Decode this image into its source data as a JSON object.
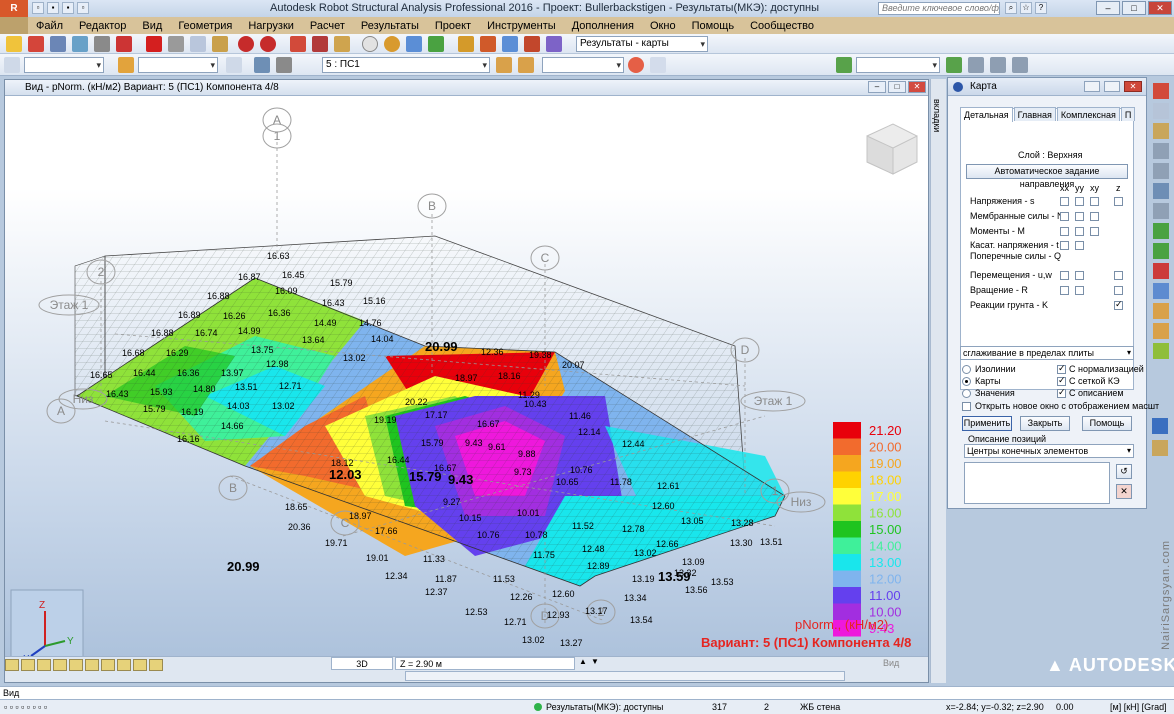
{
  "window": {
    "title": "Autodesk Robot Structural Analysis Professional 2016 - Проект: Bullerbackstigen - Результаты(МКЭ): доступны",
    "help_placeholder": "Введите ключевое слово/фразу",
    "app_logo": "R"
  },
  "menu": [
    "Файл",
    "Редактор",
    "Вид",
    "Геометрия",
    "Нагрузки",
    "Расчет",
    "Результаты",
    "Проект",
    "Инструменты",
    "Дополнения",
    "Окно",
    "Помощь",
    "Сообщество"
  ],
  "toolbar": {
    "results_combo": "Результаты - карты",
    "case_combo": "5 : ПС1"
  },
  "viewport": {
    "title": "Вид - pNorm. (кН/м2) Вариант: 5 (ПС1) Компонента 4/8",
    "bottom_tab": "3D",
    "z_value": "Z = 2.90 м",
    "bottom_right": "Вид",
    "grid_labels": [
      "A",
      "1",
      "B",
      "2",
      "C",
      "Этаж 1",
      "Низ",
      "A",
      "D",
      "Этаж 1",
      "1",
      "Низ",
      "B",
      "C",
      "D",
      "2"
    ],
    "values": [
      "16.63",
      "16.45",
      "16.87",
      "15.79",
      "16.88",
      "16.09",
      "16.43",
      "15.16",
      "16.89",
      "16.26",
      "16.36",
      "14.49",
      "14.76",
      "16.88",
      "16.74",
      "14.99",
      "13.64",
      "13.02",
      "14.04",
      "16.68",
      "16.29",
      "13.75",
      "12.98",
      "16.65",
      "16.44",
      "16.36",
      "13.97",
      "13.51",
      "12.71",
      "15.93",
      "14.80",
      "14.03",
      "13.02",
      "16.43",
      "15.79",
      "16.19",
      "14.66",
      "16.16",
      "19.38",
      "12.36",
      "20.07",
      "18.16",
      "11.29",
      "18.97",
      "10.43",
      "11.46",
      "12.14",
      "12.44",
      "20.22",
      "17.17",
      "16.67",
      "9.61",
      "9.88",
      "10.76",
      "11.78",
      "12.61",
      "19.19",
      "15.79",
      "9.43",
      "9.73",
      "10.65",
      "12.60",
      "13.05",
      "13.28",
      "18.12",
      "16.44",
      "16.67",
      "9.27",
      "10.15",
      "10.01",
      "11.52",
      "12.78",
      "12.66",
      "13.09",
      "13.30",
      "13.51",
      "18.65",
      "18.97",
      "17.66",
      "10.76",
      "10.78",
      "12.48",
      "13.02",
      "13.32",
      "13.53",
      "20.36",
      "19.71",
      "19.01",
      "11.33",
      "11.75",
      "12.89",
      "13.19",
      "13.56",
      "12.34",
      "11.87",
      "11.53",
      "12.26",
      "12.60",
      "12.37",
      "12.53",
      "12.71",
      "12.93",
      "13.17",
      "13.34",
      "13.54",
      "13.02",
      "13.27",
      "13.49"
    ],
    "big_labels": [
      "20.99",
      "20.99",
      "12.03",
      "15.79",
      "9.43",
      "13.59"
    ]
  },
  "legend": {
    "entries": [
      {
        "value": "21.20",
        "color": "#e8000b"
      },
      {
        "value": "20.00",
        "color": "#f26b2d"
      },
      {
        "value": "19.00",
        "color": "#f5a61f"
      },
      {
        "value": "18.00",
        "color": "#ffd200"
      },
      {
        "value": "17.00",
        "color": "#ffff3a"
      },
      {
        "value": "16.00",
        "color": "#8fe23a"
      },
      {
        "value": "15.00",
        "color": "#1fc41f"
      },
      {
        "value": "14.00",
        "color": "#3ff09a"
      },
      {
        "value": "13.00",
        "color": "#19e6ec"
      },
      {
        "value": "12.00",
        "color": "#7fb4ee"
      },
      {
        "value": "11.00",
        "color": "#6440ee"
      },
      {
        "value": "10.00",
        "color": "#a22ee0"
      },
      {
        "value": "9.43",
        "color": "#ee18dc"
      }
    ],
    "quantity": "pNorm., (кН/м2)",
    "variant": "Вариант: 5 (ПС1) Компонента 4/8"
  },
  "panel": {
    "title": "Карта",
    "tabs": [
      "Детальная",
      "Главная",
      "Комплексная",
      "П"
    ],
    "layer": "Слой : Верхняя",
    "auto_dir_button": "Автоматическое задание направления",
    "col_headers": [
      "xx",
      "yy",
      "xy",
      "z"
    ],
    "rows": [
      "Напряжения - s",
      "Мембранные силы - N",
      "Моменты - M",
      "Касат. напряжения - t",
      "Поперечные силы - Q",
      "Перемещения - u,w",
      "Вращение - R",
      "Реакции грунта - K"
    ],
    "smoothing": "сглаживание в пределах плиты",
    "opt_isolines": "Изолинии",
    "opt_maps": "Карты",
    "opt_values": "Значения",
    "chk_normalize": "С нормализацией",
    "chk_mesh": "С сеткой КЭ",
    "chk_description": "С описанием",
    "chk_new_window": "Открыть новое окно с отображением масшт",
    "btn_apply": "Применить",
    "btn_close": "Закрыть",
    "btn_help": "Помощь",
    "desc_label": "Описание позиций",
    "desc_combo": "Центры конечных элементов"
  },
  "side_strip": "вкладки",
  "watermark": "NairiSargsyan.com",
  "brand": "AUTODESK.",
  "status": {
    "line1": "Вид",
    "results": "Результаты(МКЭ): доступны",
    "num1": "317",
    "num2": "2",
    "material": "ЖБ стена",
    "coords": "x=-2.84; y=-0.32; z=2.90",
    "val": "0.00",
    "units": "[м] [кН] [Grad]"
  }
}
